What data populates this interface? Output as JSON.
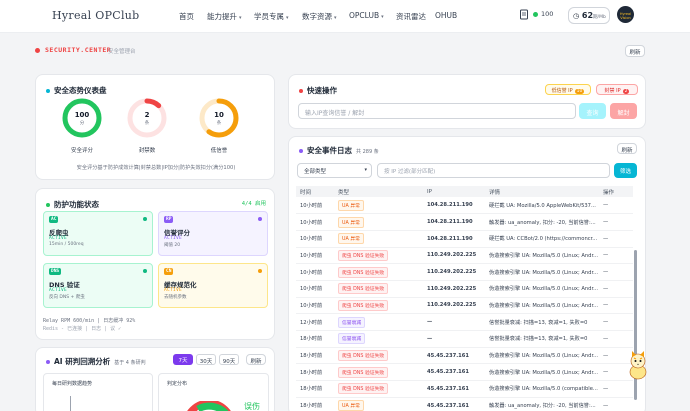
{
  "nav": {
    "logo": "Hyreal OPClub",
    "items": [
      {
        "label": "首页",
        "caret": ""
      },
      {
        "label": "能力提升",
        "caret": "▾"
      },
      {
        "label": "学员专属",
        "caret": "▾"
      },
      {
        "label": "数字资源",
        "caret": "▾"
      },
      {
        "label": "OPCLUB",
        "caret": "▾"
      },
      {
        "label": "资讯雷达",
        "caret": ""
      },
      {
        "label": "OHUB",
        "caret": ""
      }
    ],
    "coins": "100",
    "wallet_value": "62",
    "wallet_unit": "期/Mb",
    "avatar_text": "Hyreal Vision"
  },
  "security": {
    "title": "SECURITY.CENTER",
    "subtitle": "安全管理台",
    "refresh_label": "刷新"
  },
  "dashboard": {
    "title": "安全态势仪表盘",
    "gauges": [
      {
        "value": "100",
        "unit": "分",
        "label": "安全评分",
        "color": "#22c55e",
        "track": "#dcfce7",
        "pct": 1.0
      },
      {
        "value": "2",
        "unit": "条",
        "label": "封禁数",
        "color": "#ef4444",
        "track": "#fde2e2",
        "pct": 0.12
      },
      {
        "value": "10",
        "unit": "条",
        "label": "低信誉",
        "color": "#f59e0b",
        "track": "#fde9c8",
        "pct": 0.6
      }
    ],
    "note": "安全评分基于防护成效计算|封禁总数|IP加分|防护失效扣分(满分100)"
  },
  "protection": {
    "title": "防护功能状态",
    "count": "4/4 启用",
    "items": [
      {
        "tag": "AC",
        "name": "反爬虫",
        "state": "ACTIVE",
        "detail": "15min / 500req",
        "bg": "#ecfdf5",
        "border": "#a7f3d0",
        "tagbg": "#10b981",
        "statecolor": "#10b981",
        "dot": "#10b981"
      },
      {
        "tag": "RP",
        "name": "信誉评分",
        "state": "ACTIVE",
        "detail": "阈值 20",
        "bg": "#f5f3ff",
        "border": "#ddd6fe",
        "tagbg": "#8b5cf6",
        "statecolor": "#8b5cf6",
        "dot": "#8b5cf6"
      },
      {
        "tag": "DNS",
        "name": "DNS 验证",
        "state": "ACTIVE",
        "detail": "反向 DNS + 爬虫",
        "bg": "#ecfdf5",
        "border": "#a7f3d0",
        "tagbg": "#10b981",
        "statecolor": "#10b981",
        "dot": "#10b981"
      },
      {
        "tag": "CN",
        "name": "缓存规范化",
        "state": "ACTIVE",
        "detail": "去随机参数",
        "bg": "#fffbeb",
        "border": "#fde68a",
        "tagbg": "#f59e0b",
        "statecolor": "#f59e0b",
        "dot": "#f59e0b"
      }
    ],
    "relay": "Relay RPM 600/min | 日志缓冲 92%",
    "relay_sub": "Redis - 已连接 | 日志 | 议 ✓"
  },
  "analysis": {
    "title": "AI 研判回溯分析",
    "subtitle": "基于 4 条研判",
    "ranges": [
      "7天",
      "30天",
      "90天"
    ],
    "refresh_label": "刷新",
    "trend_title": "每日研判数据趋势",
    "dist_title": "判定分布",
    "dist_text": "误伤"
  },
  "quick": {
    "title": "快速操作",
    "pill_low": "低信誉 IP",
    "pill_low_count": "10",
    "pill_ban": "封禁 IP",
    "pill_ban_count": "2",
    "input_placeholder": "输入IP查询信誉 / 解封",
    "query_label": "查询",
    "unban_label": "解封"
  },
  "events": {
    "title": "安全事件日志",
    "count": "共 289 条",
    "refresh_label": "刷新",
    "filter_value": "全部类型",
    "filter_placeholder": "按 IP 过滤(部分匹配)",
    "filter_button": "筛选",
    "columns": [
      "时间",
      "类型",
      "IP",
      "详情",
      "操作"
    ],
    "rows": [
      {
        "time": "10小时前",
        "type": "UA 异常",
        "kind": "orange",
        "ip": "104.28.211.190",
        "detail": "硬拦截 UA: Mozilla/5.0 AppleWebKit/537...",
        "op": "—"
      },
      {
        "time": "10小时前",
        "type": "UA 异常",
        "kind": "orange",
        "ip": "104.28.211.190",
        "detail": "触发器: ua_anomaly, 扣分: -20, 当前信誉:...",
        "op": "—"
      },
      {
        "time": "10小时前",
        "type": "UA 异常",
        "kind": "orange",
        "ip": "104.28.211.190",
        "detail": "硬拦截 UA: CCBot/2.0 (https://commoncr...",
        "op": "—"
      },
      {
        "time": "10小时前",
        "type": "爬虫 DNS 验证失败",
        "kind": "red",
        "ip": "110.249.202.225",
        "detail": "伪造搜索引擎 UA: Mozilla/5.0 (Linux; Andr...",
        "op": "—"
      },
      {
        "time": "10小时前",
        "type": "爬虫 DNS 验证失败",
        "kind": "red",
        "ip": "110.249.202.225",
        "detail": "伪造搜索引擎 UA: Mozilla/5.0 (Linux; Andr...",
        "op": "—"
      },
      {
        "time": "10小时前",
        "type": "爬虫 DNS 验证失败",
        "kind": "red",
        "ip": "110.249.202.225",
        "detail": "伪造搜索引擎 UA: Mozilla/5.0 (Linux; Andr...",
        "op": "—"
      },
      {
        "time": "10小时前",
        "type": "爬虫 DNS 验证失败",
        "kind": "red",
        "ip": "110.249.202.225",
        "detail": "伪造搜索引擎 UA: Mozilla/5.0 (Linux; Andr...",
        "op": "—"
      },
      {
        "time": "12小时前",
        "type": "信誉衰减",
        "kind": "purple",
        "ip": "—",
        "detail": "信誉批量衰减: 扫描=13, 衰减=1, 失败=0",
        "op": "—"
      },
      {
        "time": "18小时前",
        "type": "信誉衰减",
        "kind": "purple",
        "ip": "—",
        "detail": "信誉批量衰减: 扫描=13, 衰减=1, 失败=0",
        "op": "—"
      },
      {
        "time": "18小时前",
        "type": "爬虫 DNS 验证失败",
        "kind": "red",
        "ip": "45.45.237.161",
        "detail": "伪造搜索引擎 UA: Mozilla/5.0 (Linux; Andr...",
        "op": "—"
      },
      {
        "time": "18小时前",
        "type": "爬虫 DNS 验证失败",
        "kind": "red",
        "ip": "45.45.237.161",
        "detail": "伪造搜索引擎 UA: Mozilla/5.0 (Linux; Andr...",
        "op": "—"
      },
      {
        "time": "18小时前",
        "type": "爬虫 DNS 验证失败",
        "kind": "red",
        "ip": "45.45.237.161",
        "detail": "伪造搜索引擎 UA: Mozilla/5.0 (compatible...",
        "op": "—"
      },
      {
        "time": "18小时前",
        "type": "UA 异常",
        "kind": "orange",
        "ip": "45.45.237.161",
        "detail": "触发器: ua_anomaly, 扣分: -20, 当前信誉:...",
        "op": "—"
      }
    ]
  }
}
